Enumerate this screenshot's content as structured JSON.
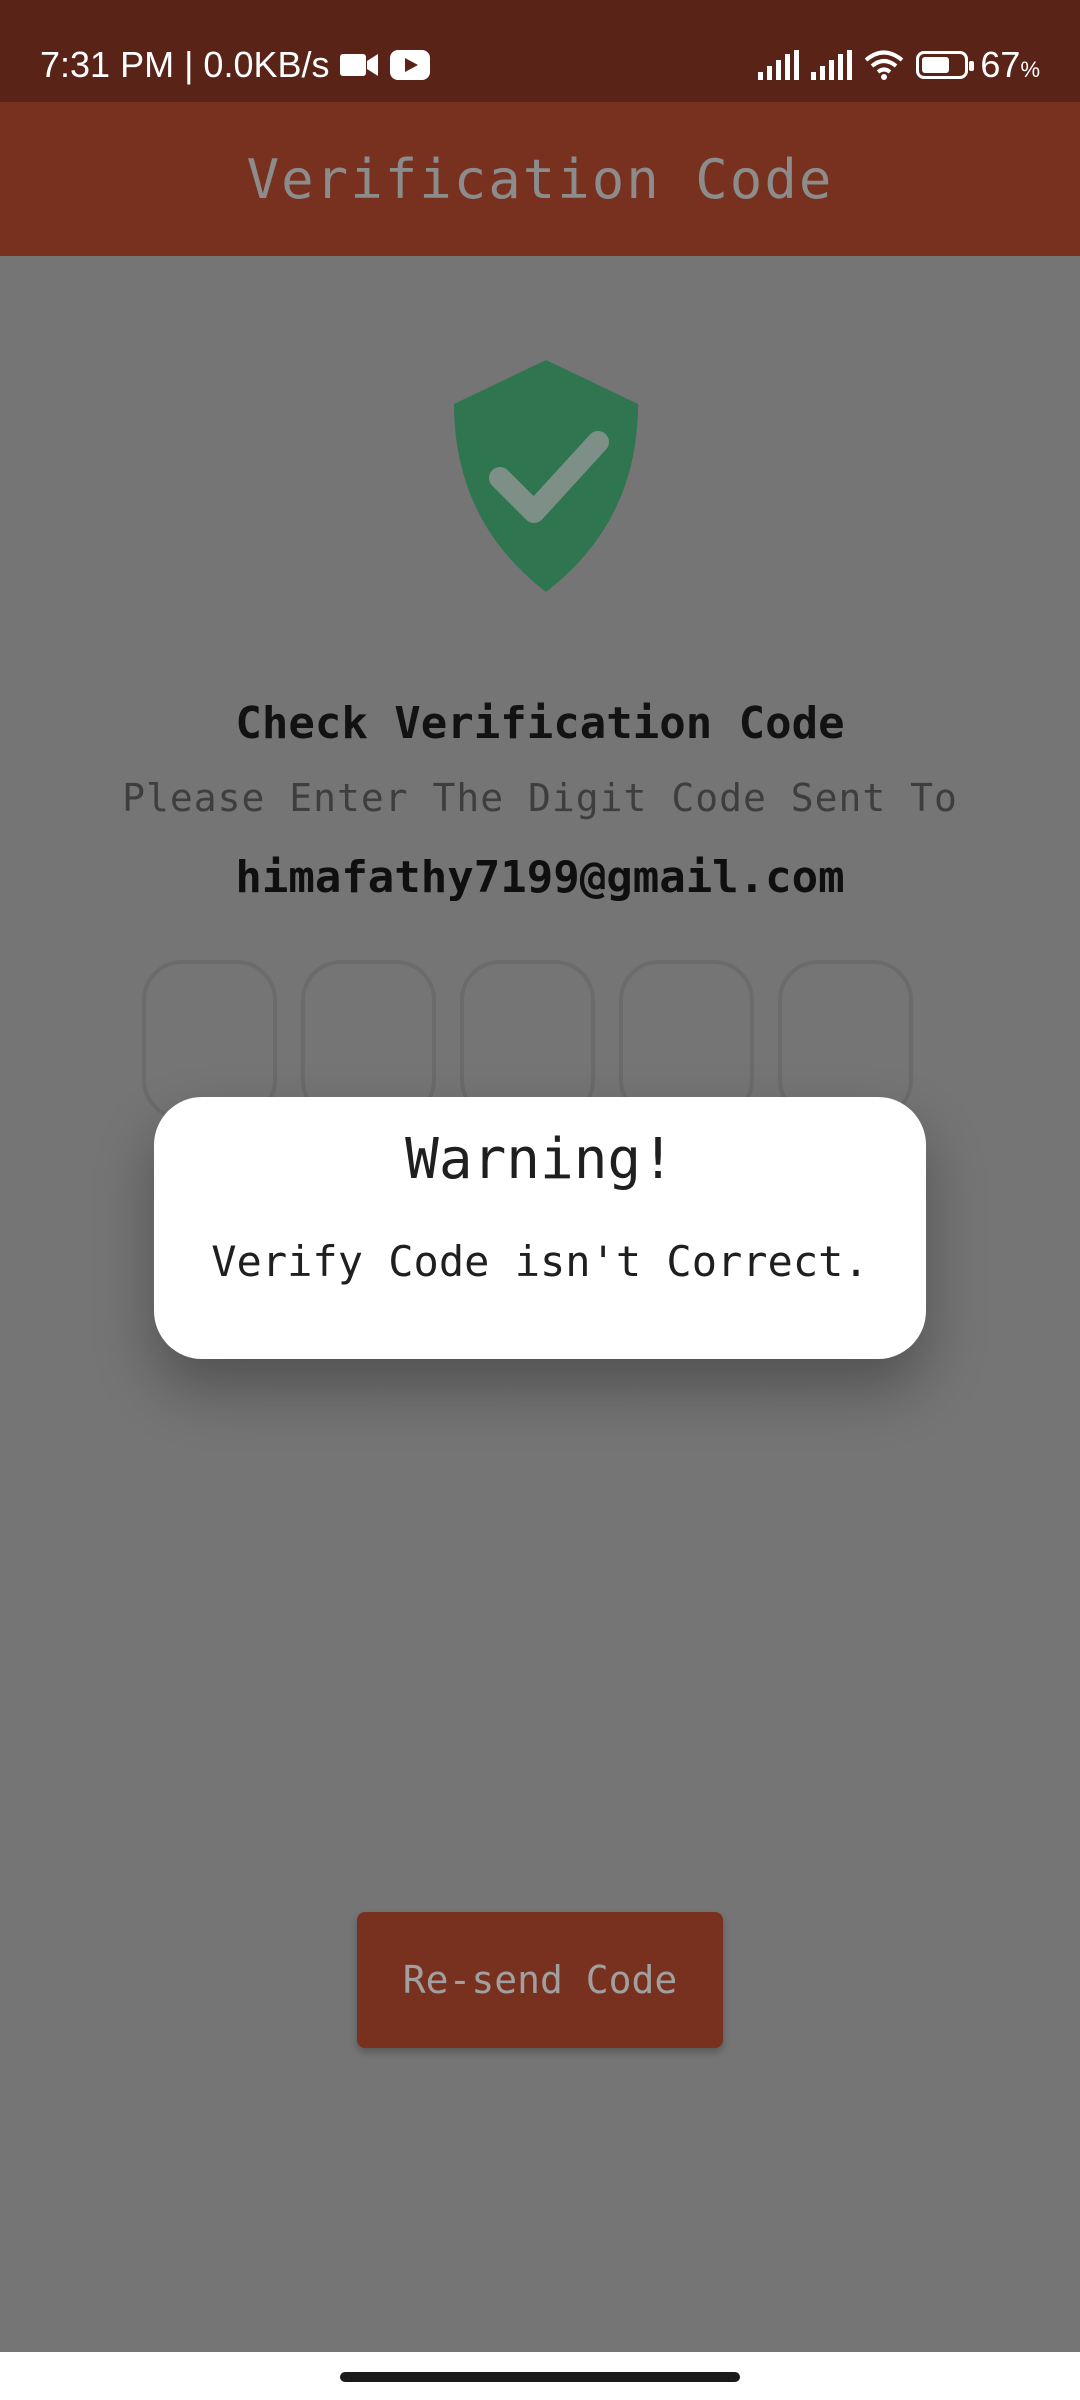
{
  "status_bar": {
    "time_text": "7:31 PM | 0.0KB/s",
    "battery_level": "67",
    "battery_unit": "%",
    "battery_fraction": 0.67,
    "icons": [
      "video-camera-icon",
      "youtube-icon",
      "signal-icon",
      "signal-icon",
      "wifi-icon",
      "battery-icon"
    ]
  },
  "app_bar": {
    "title": "Verification Code"
  },
  "content": {
    "heading": "Check Verification Code",
    "subheading": "Please Enter The Digit Code Sent To",
    "email": "himafathy7199@gmail.com",
    "otp_boxes": [
      "",
      "",
      "",
      "",
      ""
    ],
    "icon": "shield-check-icon"
  },
  "dialog": {
    "title": "Warning!",
    "message": "Verify Code isn't Correct."
  },
  "resend_button": {
    "label": "Re-send Code"
  },
  "colors": {
    "status_bar": "#5a2318",
    "app_bar": "#79311f",
    "scrim_background": "#757575",
    "shield_green": "#2e7550",
    "dialog_background": "#ffffff"
  }
}
